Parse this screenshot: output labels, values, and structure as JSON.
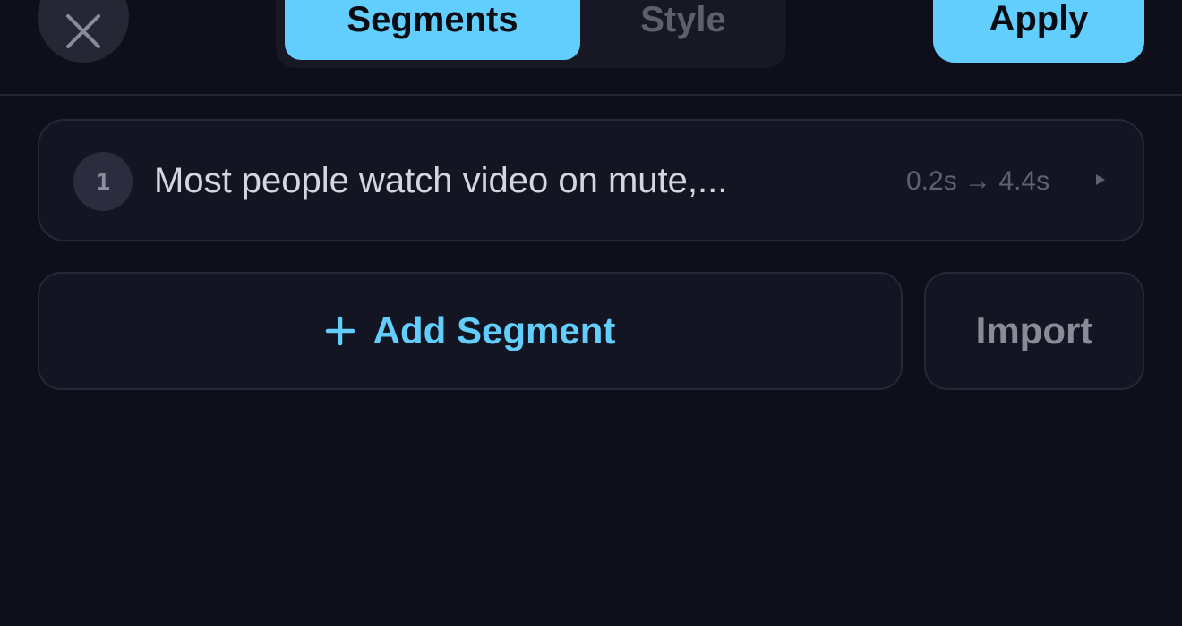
{
  "header": {
    "close_icon": "close-icon",
    "tabs": [
      {
        "label": "Segments",
        "active": true
      },
      {
        "label": "Style",
        "active": false
      }
    ],
    "apply_label": "Apply"
  },
  "segments": [
    {
      "index": "1",
      "text": "Most people watch video on mute,...",
      "time": "0.2s → 4.4s",
      "expand_icon": "play-triangle-icon"
    }
  ],
  "actions": {
    "add_icon": "plus-icon",
    "add_label": "Add Segment",
    "import_label": "Import"
  },
  "colors": {
    "accent": "#62cefd",
    "background": "#0e0f1a",
    "card": "#141522",
    "border": "#262737"
  }
}
